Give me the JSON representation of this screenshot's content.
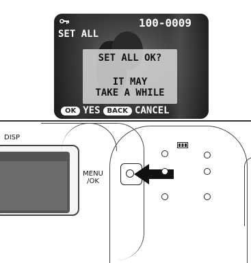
{
  "lcd": {
    "file_number": "100-0009",
    "mode_label": "SET ALL",
    "protect_icon": "key-protect-icon",
    "dialog": {
      "question": "SET ALL OK?",
      "line1": "IT MAY",
      "line2": "TAKE A WHILE"
    },
    "bottom_bar": {
      "ok_button": "OK",
      "ok_action": "YES",
      "back_button": "BACK",
      "back_action": "CANCEL"
    }
  },
  "camera_body": {
    "disp_label": "DISP",
    "menu_label_line1": "MENU",
    "menu_label_line2": "/OK",
    "battery_icon": "battery-icon",
    "press_arrow_icon": "press-arrow-icon"
  }
}
